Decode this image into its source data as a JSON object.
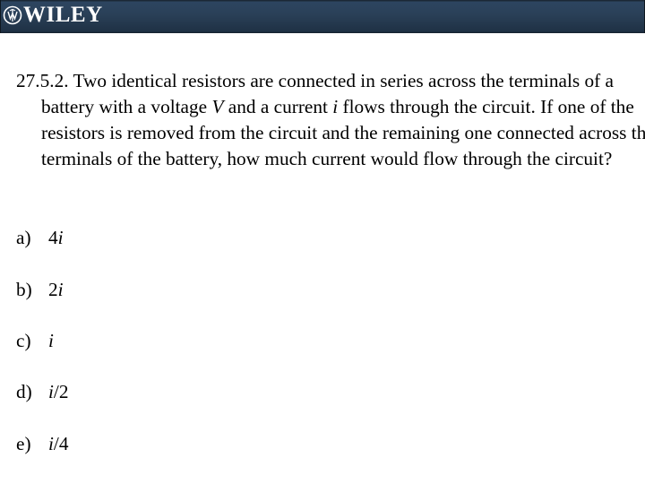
{
  "header": {
    "brand": "WILEY",
    "logo_icon": "wiley-emblem-icon",
    "background_color": "#2a4058"
  },
  "question": {
    "number": "27.5.2.",
    "text_parts": [
      " Two identical resistors are connected in series across the terminals of a battery with a voltage ",
      "V",
      " and a current ",
      "i",
      " flows through the circuit.  If one of the resistors is removed from the circuit and the remaining one connected across the terminals of the battery, how much current would flow through the circuit?"
    ]
  },
  "options": [
    {
      "letter": "a)",
      "prefix": "4",
      "var": "i",
      "suffix": ""
    },
    {
      "letter": "b)",
      "prefix": "2",
      "var": "i",
      "suffix": ""
    },
    {
      "letter": "c)",
      "prefix": "",
      "var": "i",
      "suffix": ""
    },
    {
      "letter": "d)",
      "prefix": "",
      "var": "i",
      "suffix": "/2"
    },
    {
      "letter": "e)",
      "prefix": "",
      "var": "i",
      "suffix": "/4"
    }
  ]
}
